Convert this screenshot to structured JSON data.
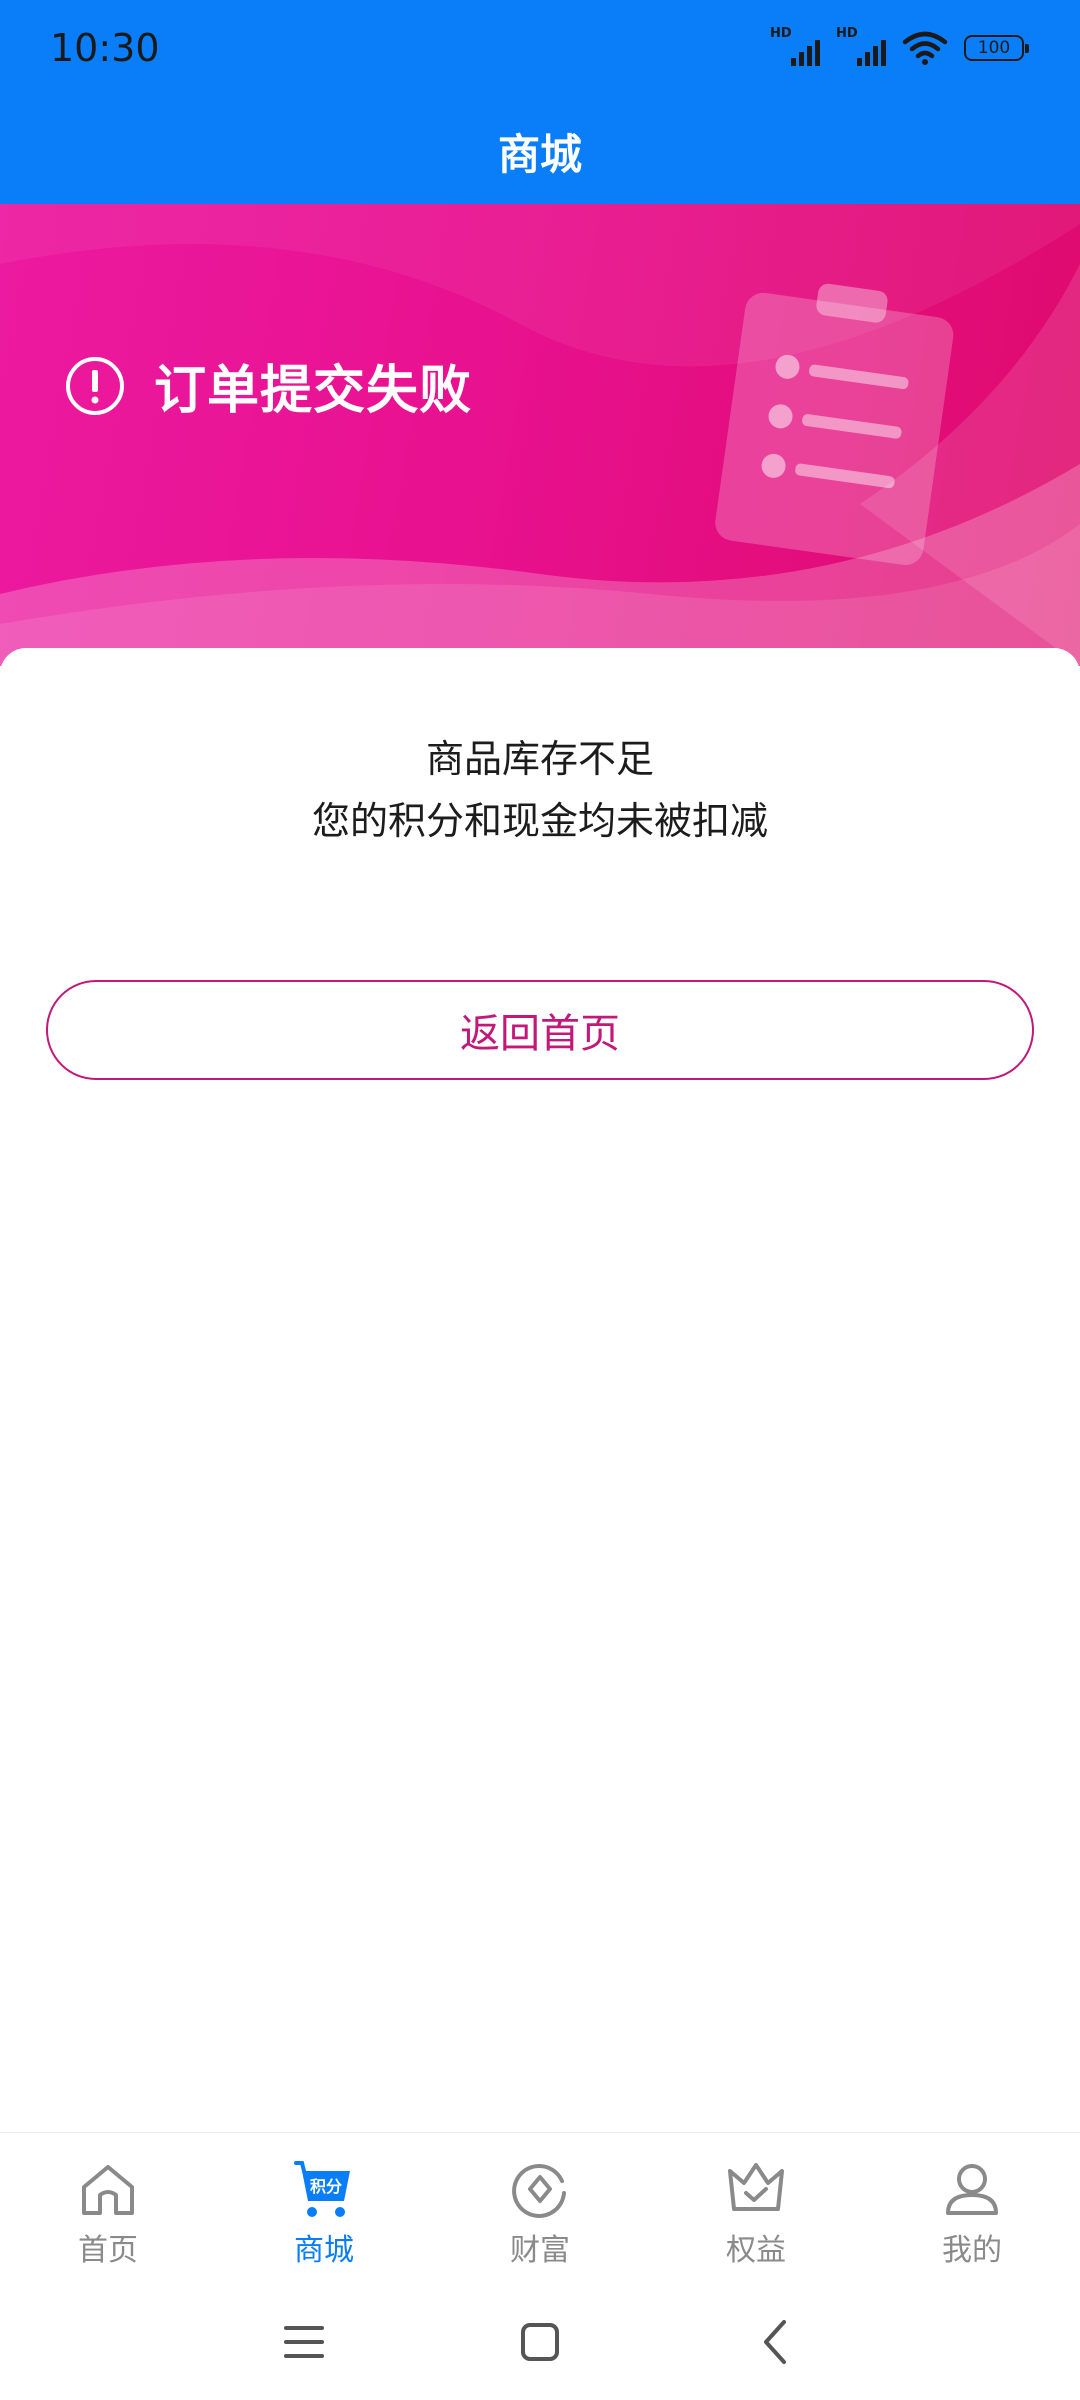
{
  "status_bar": {
    "time": "10:30",
    "sim1_label": "HD",
    "sim2_label": "HD",
    "battery": "100"
  },
  "header": {
    "title": "商城"
  },
  "banner": {
    "status_message": "订单提交失败",
    "colors": {
      "start": "#ec1aa0",
      "end": "#df0a6c"
    }
  },
  "result": {
    "line1": "商品库存不足",
    "line2": "您的积分和现金均未被扣减",
    "back_button_label": "返回首页"
  },
  "bottom_nav": {
    "items": [
      {
        "label": "首页",
        "icon": "home-icon",
        "active": false
      },
      {
        "label": "商城",
        "icon": "points-cart-icon",
        "icon_text": "积分",
        "active": true
      },
      {
        "label": "财富",
        "icon": "wealth-icon",
        "active": false
      },
      {
        "label": "权益",
        "icon": "crown-icon",
        "active": false
      },
      {
        "label": "我的",
        "icon": "profile-icon",
        "active": false
      }
    ]
  },
  "colors": {
    "primary_blue": "#0a7ef8",
    "accent_magenta": "#c2187a",
    "inactive_gray": "#8a8a8a"
  }
}
